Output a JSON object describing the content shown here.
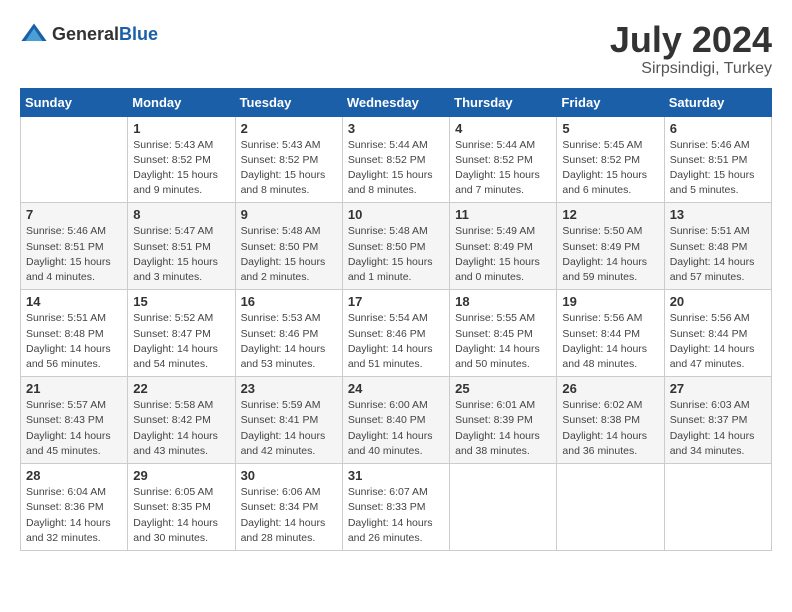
{
  "header": {
    "logo_general": "General",
    "logo_blue": "Blue",
    "month_year": "July 2024",
    "location": "Sirpsindigi, Turkey"
  },
  "calendar": {
    "days_of_week": [
      "Sunday",
      "Monday",
      "Tuesday",
      "Wednesday",
      "Thursday",
      "Friday",
      "Saturday"
    ],
    "weeks": [
      [
        {
          "day": "",
          "info": ""
        },
        {
          "day": "1",
          "info": "Sunrise: 5:43 AM\nSunset: 8:52 PM\nDaylight: 15 hours\nand 9 minutes."
        },
        {
          "day": "2",
          "info": "Sunrise: 5:43 AM\nSunset: 8:52 PM\nDaylight: 15 hours\nand 8 minutes."
        },
        {
          "day": "3",
          "info": "Sunrise: 5:44 AM\nSunset: 8:52 PM\nDaylight: 15 hours\nand 8 minutes."
        },
        {
          "day": "4",
          "info": "Sunrise: 5:44 AM\nSunset: 8:52 PM\nDaylight: 15 hours\nand 7 minutes."
        },
        {
          "day": "5",
          "info": "Sunrise: 5:45 AM\nSunset: 8:52 PM\nDaylight: 15 hours\nand 6 minutes."
        },
        {
          "day": "6",
          "info": "Sunrise: 5:46 AM\nSunset: 8:51 PM\nDaylight: 15 hours\nand 5 minutes."
        }
      ],
      [
        {
          "day": "7",
          "info": "Sunrise: 5:46 AM\nSunset: 8:51 PM\nDaylight: 15 hours\nand 4 minutes."
        },
        {
          "day": "8",
          "info": "Sunrise: 5:47 AM\nSunset: 8:51 PM\nDaylight: 15 hours\nand 3 minutes."
        },
        {
          "day": "9",
          "info": "Sunrise: 5:48 AM\nSunset: 8:50 PM\nDaylight: 15 hours\nand 2 minutes."
        },
        {
          "day": "10",
          "info": "Sunrise: 5:48 AM\nSunset: 8:50 PM\nDaylight: 15 hours\nand 1 minute."
        },
        {
          "day": "11",
          "info": "Sunrise: 5:49 AM\nSunset: 8:49 PM\nDaylight: 15 hours\nand 0 minutes."
        },
        {
          "day": "12",
          "info": "Sunrise: 5:50 AM\nSunset: 8:49 PM\nDaylight: 14 hours\nand 59 minutes."
        },
        {
          "day": "13",
          "info": "Sunrise: 5:51 AM\nSunset: 8:48 PM\nDaylight: 14 hours\nand 57 minutes."
        }
      ],
      [
        {
          "day": "14",
          "info": "Sunrise: 5:51 AM\nSunset: 8:48 PM\nDaylight: 14 hours\nand 56 minutes."
        },
        {
          "day": "15",
          "info": "Sunrise: 5:52 AM\nSunset: 8:47 PM\nDaylight: 14 hours\nand 54 minutes."
        },
        {
          "day": "16",
          "info": "Sunrise: 5:53 AM\nSunset: 8:46 PM\nDaylight: 14 hours\nand 53 minutes."
        },
        {
          "day": "17",
          "info": "Sunrise: 5:54 AM\nSunset: 8:46 PM\nDaylight: 14 hours\nand 51 minutes."
        },
        {
          "day": "18",
          "info": "Sunrise: 5:55 AM\nSunset: 8:45 PM\nDaylight: 14 hours\nand 50 minutes."
        },
        {
          "day": "19",
          "info": "Sunrise: 5:56 AM\nSunset: 8:44 PM\nDaylight: 14 hours\nand 48 minutes."
        },
        {
          "day": "20",
          "info": "Sunrise: 5:56 AM\nSunset: 8:44 PM\nDaylight: 14 hours\nand 47 minutes."
        }
      ],
      [
        {
          "day": "21",
          "info": "Sunrise: 5:57 AM\nSunset: 8:43 PM\nDaylight: 14 hours\nand 45 minutes."
        },
        {
          "day": "22",
          "info": "Sunrise: 5:58 AM\nSunset: 8:42 PM\nDaylight: 14 hours\nand 43 minutes."
        },
        {
          "day": "23",
          "info": "Sunrise: 5:59 AM\nSunset: 8:41 PM\nDaylight: 14 hours\nand 42 minutes."
        },
        {
          "day": "24",
          "info": "Sunrise: 6:00 AM\nSunset: 8:40 PM\nDaylight: 14 hours\nand 40 minutes."
        },
        {
          "day": "25",
          "info": "Sunrise: 6:01 AM\nSunset: 8:39 PM\nDaylight: 14 hours\nand 38 minutes."
        },
        {
          "day": "26",
          "info": "Sunrise: 6:02 AM\nSunset: 8:38 PM\nDaylight: 14 hours\nand 36 minutes."
        },
        {
          "day": "27",
          "info": "Sunrise: 6:03 AM\nSunset: 8:37 PM\nDaylight: 14 hours\nand 34 minutes."
        }
      ],
      [
        {
          "day": "28",
          "info": "Sunrise: 6:04 AM\nSunset: 8:36 PM\nDaylight: 14 hours\nand 32 minutes."
        },
        {
          "day": "29",
          "info": "Sunrise: 6:05 AM\nSunset: 8:35 PM\nDaylight: 14 hours\nand 30 minutes."
        },
        {
          "day": "30",
          "info": "Sunrise: 6:06 AM\nSunset: 8:34 PM\nDaylight: 14 hours\nand 28 minutes."
        },
        {
          "day": "31",
          "info": "Sunrise: 6:07 AM\nSunset: 8:33 PM\nDaylight: 14 hours\nand 26 minutes."
        },
        {
          "day": "",
          "info": ""
        },
        {
          "day": "",
          "info": ""
        },
        {
          "day": "",
          "info": ""
        }
      ]
    ]
  }
}
